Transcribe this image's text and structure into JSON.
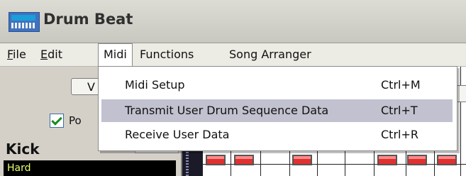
{
  "window": {
    "title": "Drum Beat",
    "icon": "app-icon"
  },
  "menubar": [
    {
      "label": "File",
      "mnemonic": "F",
      "rest": "ile"
    },
    {
      "label": "Edit",
      "mnemonic": "E",
      "rest": "dit"
    },
    {
      "label": "Midi",
      "mnemonic": "",
      "rest": "Midi"
    },
    {
      "label": "Functions",
      "mnemonic": "",
      "rest": "Functions"
    },
    {
      "label": "Song Arranger",
      "mnemonic": "",
      "rest": "Song Arranger"
    }
  ],
  "midi_menu": {
    "items": [
      {
        "label": "Midi Setup",
        "shortcut": "Ctrl+M",
        "highlighted": false
      },
      {
        "label": "Transmit User Drum Sequence Data",
        "shortcut": "Ctrl+T",
        "highlighted": true
      },
      {
        "label": "Receive User Data",
        "shortcut": "Ctrl+R",
        "highlighted": false
      }
    ]
  },
  "panel": {
    "button_label": "V",
    "checkbox_label": "Po",
    "checkbox_checked": true,
    "instrument": "Kick",
    "variation": "Hard"
  },
  "colors": {
    "menu_highlight": "#c2c1cf",
    "step_active": "#e03030",
    "variation_text": "#eaff6a"
  }
}
